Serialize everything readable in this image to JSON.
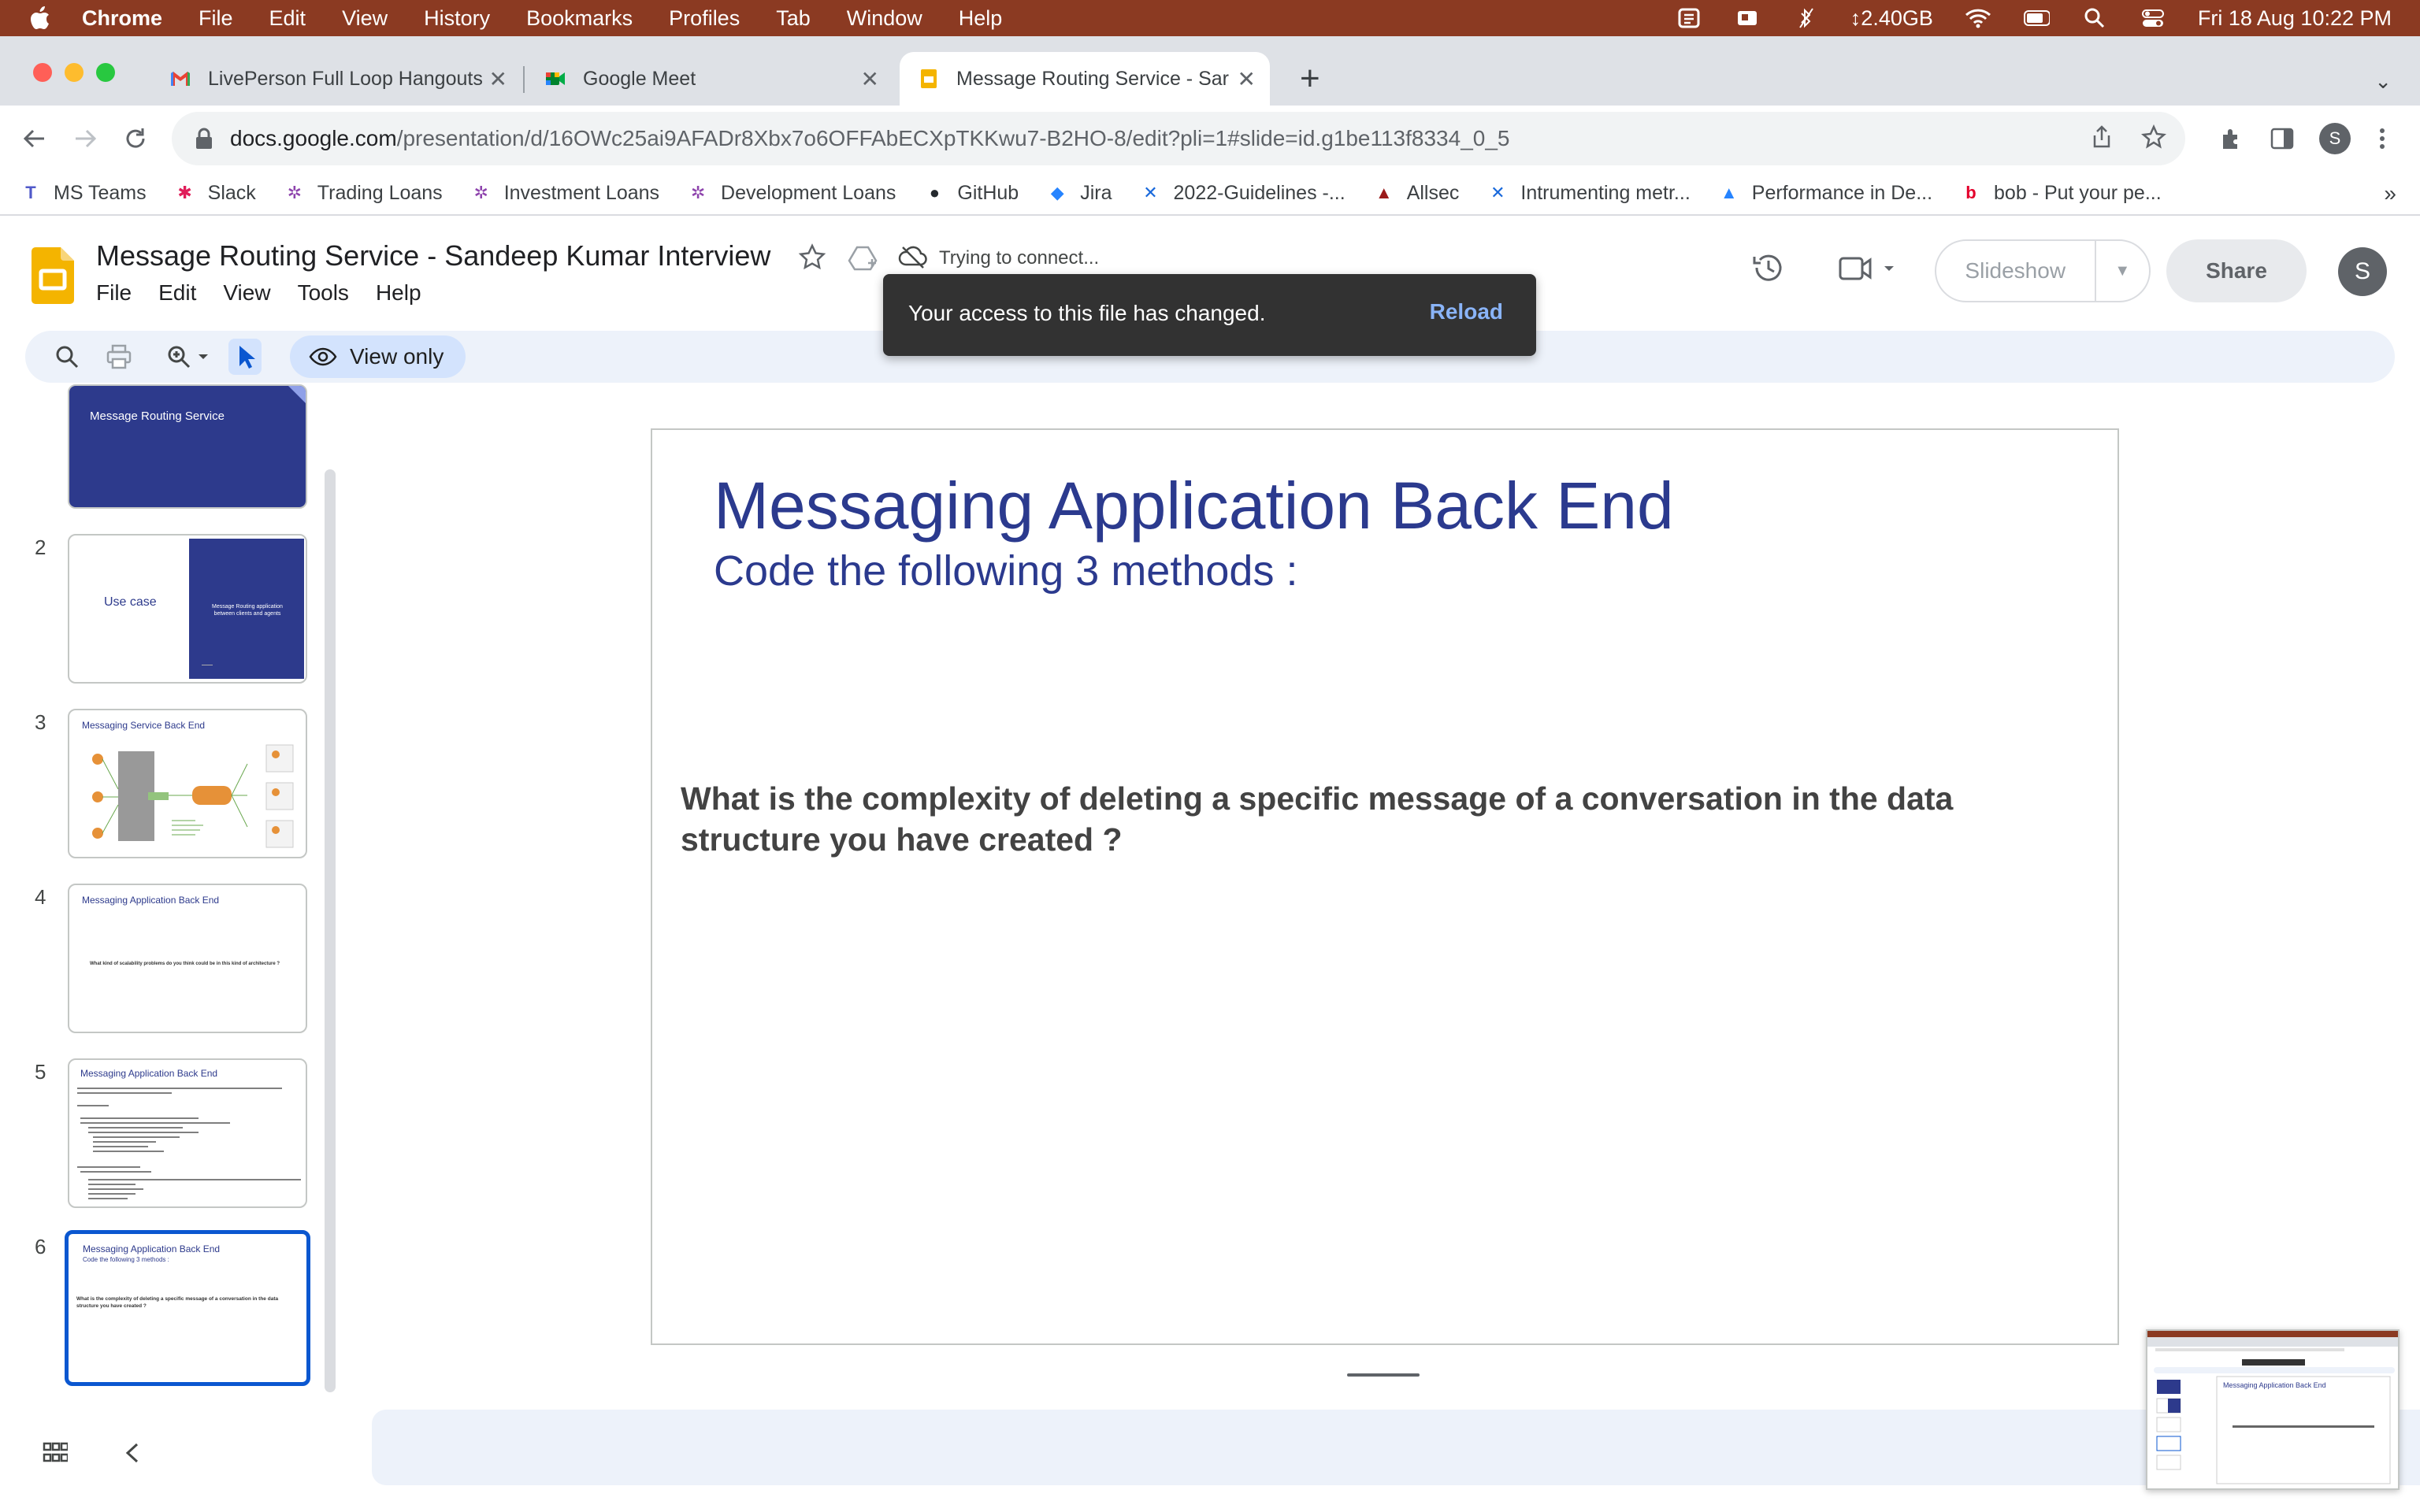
{
  "menubar": {
    "app_name": "Chrome",
    "items": [
      "File",
      "Edit",
      "View",
      "History",
      "Bookmarks",
      "Profiles",
      "Tab",
      "Window",
      "Help"
    ],
    "memory": "↕2.40GB",
    "datetime": "Fri 18 Aug  10:22 PM"
  },
  "tabs": [
    {
      "title": "LivePerson Full Loop Hangouts",
      "icon": "gmail-icon"
    },
    {
      "title": "Google Meet",
      "icon": "meet-icon"
    },
    {
      "title": "Message Routing Service - Sar",
      "icon": "slides-icon",
      "active": true
    }
  ],
  "omnibox": {
    "url_host": "docs.google.com",
    "url_path": "/presentation/d/16OWc25ai9AFADr8Xbx7o6OFFAbECXpTKKwu7-B2HO-8/edit?pli=1#slide=id.g1be113f8334_0_5",
    "profile_initial": "S"
  },
  "bookmarks": [
    {
      "label": "MS Teams",
      "icon": "teams-icon",
      "color": "#5059c9"
    },
    {
      "label": "Slack",
      "icon": "slack-icon",
      "color": "#e01e5a"
    },
    {
      "label": "Trading Loans",
      "icon": "asterisk-icon",
      "color": "#8e44ad"
    },
    {
      "label": "Investment Loans",
      "icon": "asterisk-icon",
      "color": "#8e44ad"
    },
    {
      "label": "Development Loans",
      "icon": "asterisk-icon",
      "color": "#8e44ad"
    },
    {
      "label": "GitHub",
      "icon": "github-icon",
      "color": "#24292e"
    },
    {
      "label": "Jira",
      "icon": "jira-icon",
      "color": "#2684ff"
    },
    {
      "label": "2022-Guidelines -...",
      "icon": "confluence-icon",
      "color": "#1868db"
    },
    {
      "label": "Allsec",
      "icon": "allsec-icon",
      "color": "#9b1b1b"
    },
    {
      "label": "Intrumenting metr...",
      "icon": "confluence-icon",
      "color": "#1868db"
    },
    {
      "label": "Performance in De...",
      "icon": "atlassian-icon",
      "color": "#2684ff"
    },
    {
      "label": "bob - Put your pe...",
      "icon": "bob-icon",
      "color": "#e4002b"
    }
  ],
  "doc": {
    "title": "Message Routing Service - Sandeep Kumar Interview",
    "status": "Trying to connect...",
    "menu": [
      "File",
      "Edit",
      "View",
      "Tools",
      "Help"
    ],
    "slideshow_label": "Slideshow",
    "share_label": "Share",
    "account_initial": "S"
  },
  "toolbar": {
    "view_only_label": "View only"
  },
  "toast": {
    "message": "Your access to this file has changed.",
    "action": "Reload"
  },
  "filmstrip": {
    "numbers": [
      "2",
      "3",
      "4",
      "5",
      "6"
    ],
    "slide1_title": "Message Routing Service",
    "slide2_left": "Use case",
    "slide2_right": "Message Routing application between clients and agents",
    "slide3_title": "Messaging Service Back End",
    "slide4_title": "Messaging Application Back End",
    "slide4_body": "What kind of scalability problems do you think could be in this kind of architecture ?",
    "slide5_title": "Messaging Application Back End",
    "slide6_title": "Messaging Application Back End",
    "slide6_sub": "Code the following 3 methods :",
    "slide6_body": "What is the complexity of deleting a specific message of a conversation in the data structure you have created ?"
  },
  "slide": {
    "title": "Messaging Application Back End",
    "subtitle": "Code the following 3 methods :",
    "body": "What is the complexity of deleting a specific message of a conversation in the data structure you have created ?"
  },
  "pip": {
    "title": "Messaging Application Back End"
  },
  "colors": {
    "menubar": "#8b3a22",
    "slide_title": "#2b3a8e",
    "accent": "#0b57d0",
    "thumb_dark": "#2d3a8c"
  }
}
